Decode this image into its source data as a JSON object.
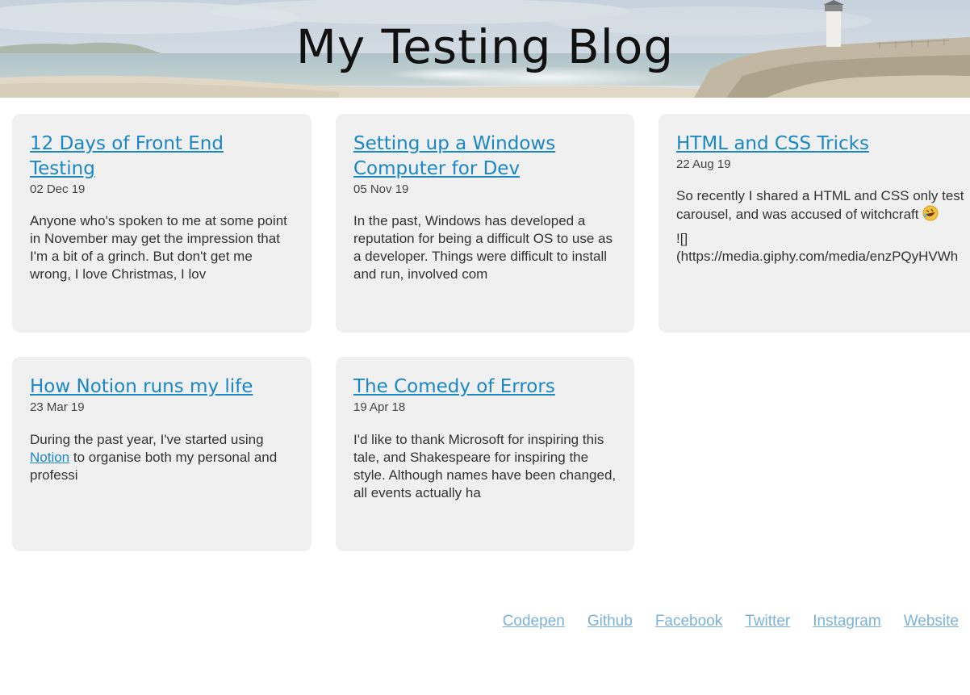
{
  "site": {
    "title": "My Testing Blog"
  },
  "posts": [
    {
      "title": "12 Days of Front End Testing",
      "date": "02 Dec 19",
      "excerpt": "Anyone who's spoken to me at some point in November may get the impression that I'm a bit of a grinch. But don't get me wrong, I love Christmas, I lov"
    },
    {
      "title": "Setting up a Windows Computer for Dev",
      "date": "05 Nov 19",
      "excerpt": "In the past, Windows has developed a reputation for being a difficult OS to use as a developer. Things were difficult to install and run, involved com"
    },
    {
      "title": "HTML and CSS Tricks",
      "date": "22 Aug 19",
      "excerpt": "So recently I shared a HTML and CSS only test carousel, and was accused of witchcraft",
      "excerpt_line2a": "![]",
      "excerpt_line2b": "(https://media.giphy.com/media/enzPQyHVWh",
      "emoji_icon": "rolling-on-floor-laughing-emoji"
    },
    {
      "title": "How Notion runs my life",
      "date": "23 Mar 19",
      "excerpt_before": "During the past year, I've started using",
      "excerpt_link": "Notion",
      "excerpt_after": "to organise both my personal and professi"
    },
    {
      "title": "The Comedy of Errors",
      "date": "19 Apr 18",
      "excerpt": "I'd like to thank Microsoft for inspiring this tale, and Shakespeare for inspiring the style. Although names have been changed, all events actually ha"
    }
  ],
  "footer": {
    "links": [
      "Codepen",
      "Github",
      "Facebook",
      "Twitter",
      "Instagram",
      "Website"
    ]
  },
  "colors": {
    "link": "#1a87c2",
    "footer_link": "#79b3d9",
    "card_bg": "#f0f0f0"
  }
}
